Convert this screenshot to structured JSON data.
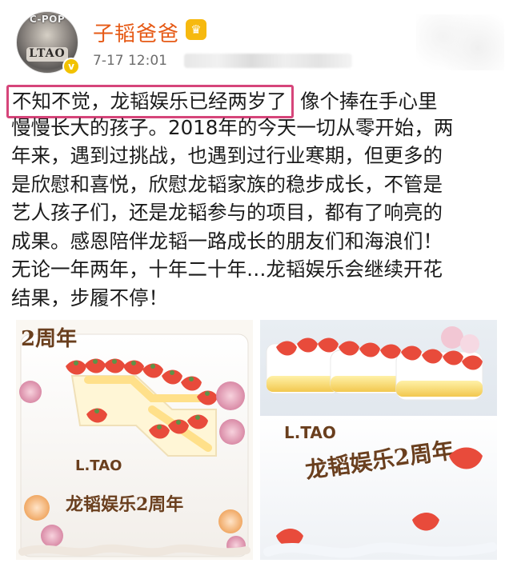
{
  "header": {
    "username": "子韬爸爸",
    "timestamp": "7-17 12:01",
    "avatar_text_top": "C-POP",
    "avatar_text_logo": "LTAO",
    "verified_icon": "verified-badge-icon",
    "crown_icon": "crown-badge-icon"
  },
  "post": {
    "lines": [
      {
        "highlight": "不知不觉，龙韬娱乐已经两岁了",
        "rest": "像个捧在手心里"
      },
      {
        "text": "慢慢长大的孩子。2018年的今天一切从零开始，两"
      },
      {
        "text": "年来，遇到过挑战，也遇到过行业寒期，但更多的"
      },
      {
        "text": "是欣慰和喜悦，欣慰龙韬家族的稳步成长，不管是"
      },
      {
        "text": "艺人孩子们，还是龙韬参与的项目，都有了响亮的"
      },
      {
        "text": "成果。感恩陪伴龙韬一路成长的朋友们和海浪们！"
      },
      {
        "text": "无论一年两年，十年二十年…龙韬娱乐会继续开花"
      },
      {
        "text": "结果，步履不停！"
      }
    ]
  },
  "images": {
    "photo1": {
      "top_text": "2周年",
      "brand": "L.TAO",
      "caption": "龙韬娱乐2周年"
    },
    "photo2": {
      "brand": "L.TAO",
      "caption": "龙韬娱乐2周年"
    }
  },
  "colors": {
    "username": "#e65a16",
    "highlight_border": "#d6457a",
    "text": "#1b1b1b",
    "meta": "#6d6d6d"
  }
}
